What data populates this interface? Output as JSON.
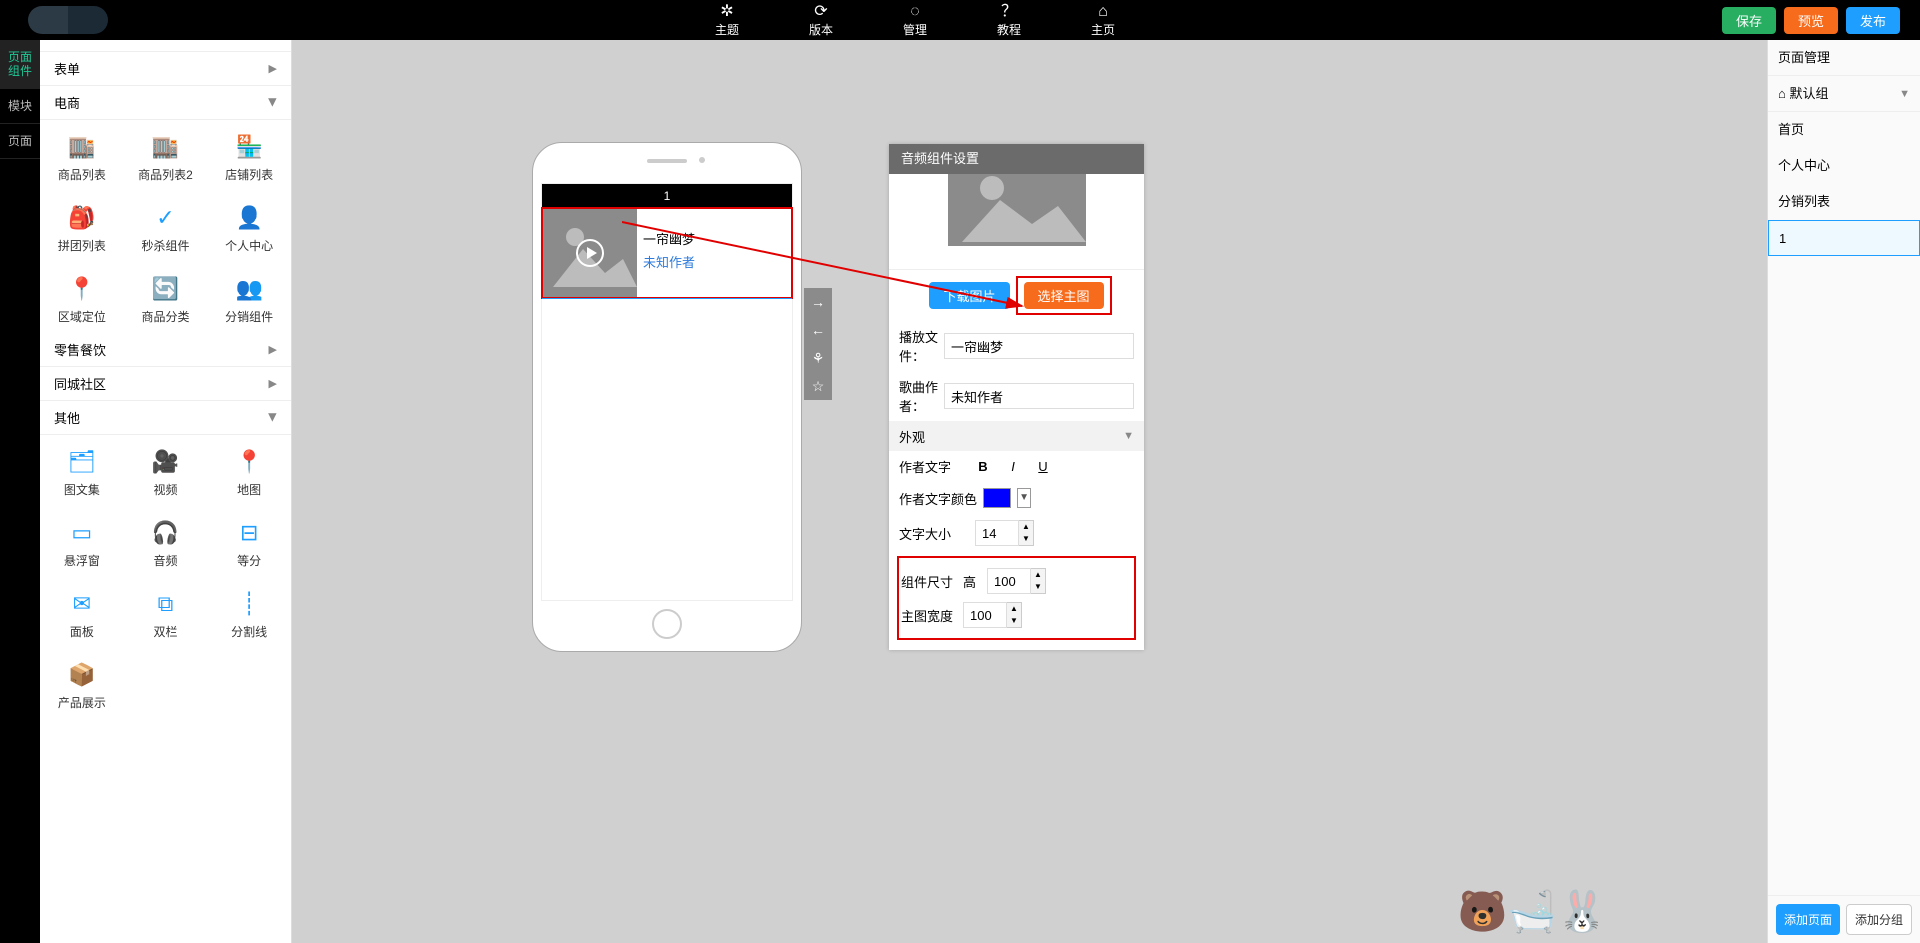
{
  "topnav": {
    "items": [
      {
        "icon": "✲",
        "label": "主题"
      },
      {
        "icon": "⟳",
        "label": "版本"
      },
      {
        "icon": "◌",
        "label": "管理"
      },
      {
        "icon": "？",
        "label": "教程"
      },
      {
        "icon": "⌂",
        "label": "主页"
      }
    ],
    "save": "保存",
    "preview": "预览",
    "publish": "发布"
  },
  "rail": {
    "tabs": [
      "页面\n组件",
      "模块",
      "页面"
    ],
    "active": 0
  },
  "sidebar": {
    "sections": {
      "form": "表单",
      "ecom": "电商",
      "retail": "零售餐饮",
      "community": "同城社区",
      "other": "其他"
    },
    "ecom_items": [
      {
        "icon": "🏬",
        "label": "商品列表"
      },
      {
        "icon": "🏬",
        "label": "商品列表2"
      },
      {
        "icon": "🏪",
        "label": "店铺列表"
      },
      {
        "icon": "🎒",
        "label": "拼团列表"
      },
      {
        "icon": "✓",
        "label": "秒杀组件"
      },
      {
        "icon": "👤",
        "label": "个人中心"
      },
      {
        "icon": "📍",
        "label": "区域定位"
      },
      {
        "icon": "🔄",
        "label": "商品分类"
      },
      {
        "icon": "👥",
        "label": "分销组件"
      }
    ],
    "other_items": [
      {
        "icon": "🗂",
        "label": "图文集"
      },
      {
        "icon": "🎥",
        "label": "视频"
      },
      {
        "icon": "📍",
        "label": "地图"
      },
      {
        "icon": "▭",
        "label": "悬浮窗"
      },
      {
        "icon": "🎧",
        "label": "音频"
      },
      {
        "icon": "⊟",
        "label": "等分"
      },
      {
        "icon": "✉",
        "label": "面板"
      },
      {
        "icon": "⧉",
        "label": "双栏"
      },
      {
        "icon": "┊",
        "label": "分割线"
      },
      {
        "icon": "📦",
        "label": "产品展示"
      }
    ]
  },
  "preview": {
    "page_title": "1",
    "audio": {
      "title": "一帘幽梦",
      "author": "未知作者"
    }
  },
  "settings": {
    "title": "音频组件设置",
    "download_btn": "下载图片",
    "pick_btn": "选择主图",
    "file_label": "播放文件：",
    "file_value": "一帘幽梦",
    "author_label": "歌曲作者：",
    "author_value": "未知作者",
    "appearance_label": "外观",
    "authortext_label": "作者文字",
    "authorcolor_label": "作者文字颜色",
    "authorcolor_value": "#0000ff",
    "fontsize_label": "文字大小",
    "fontsize_value": "14",
    "size_label": "组件尺寸",
    "height_label": "高",
    "height_value": "100",
    "imgw_label": "主图宽度",
    "imgw_value": "100"
  },
  "right": {
    "title": "页面管理",
    "group": "默认组",
    "pages": [
      "首页",
      "个人中心",
      "分销列表",
      "1"
    ],
    "active": 3,
    "add_page": "添加页面",
    "add_group": "添加分组"
  }
}
